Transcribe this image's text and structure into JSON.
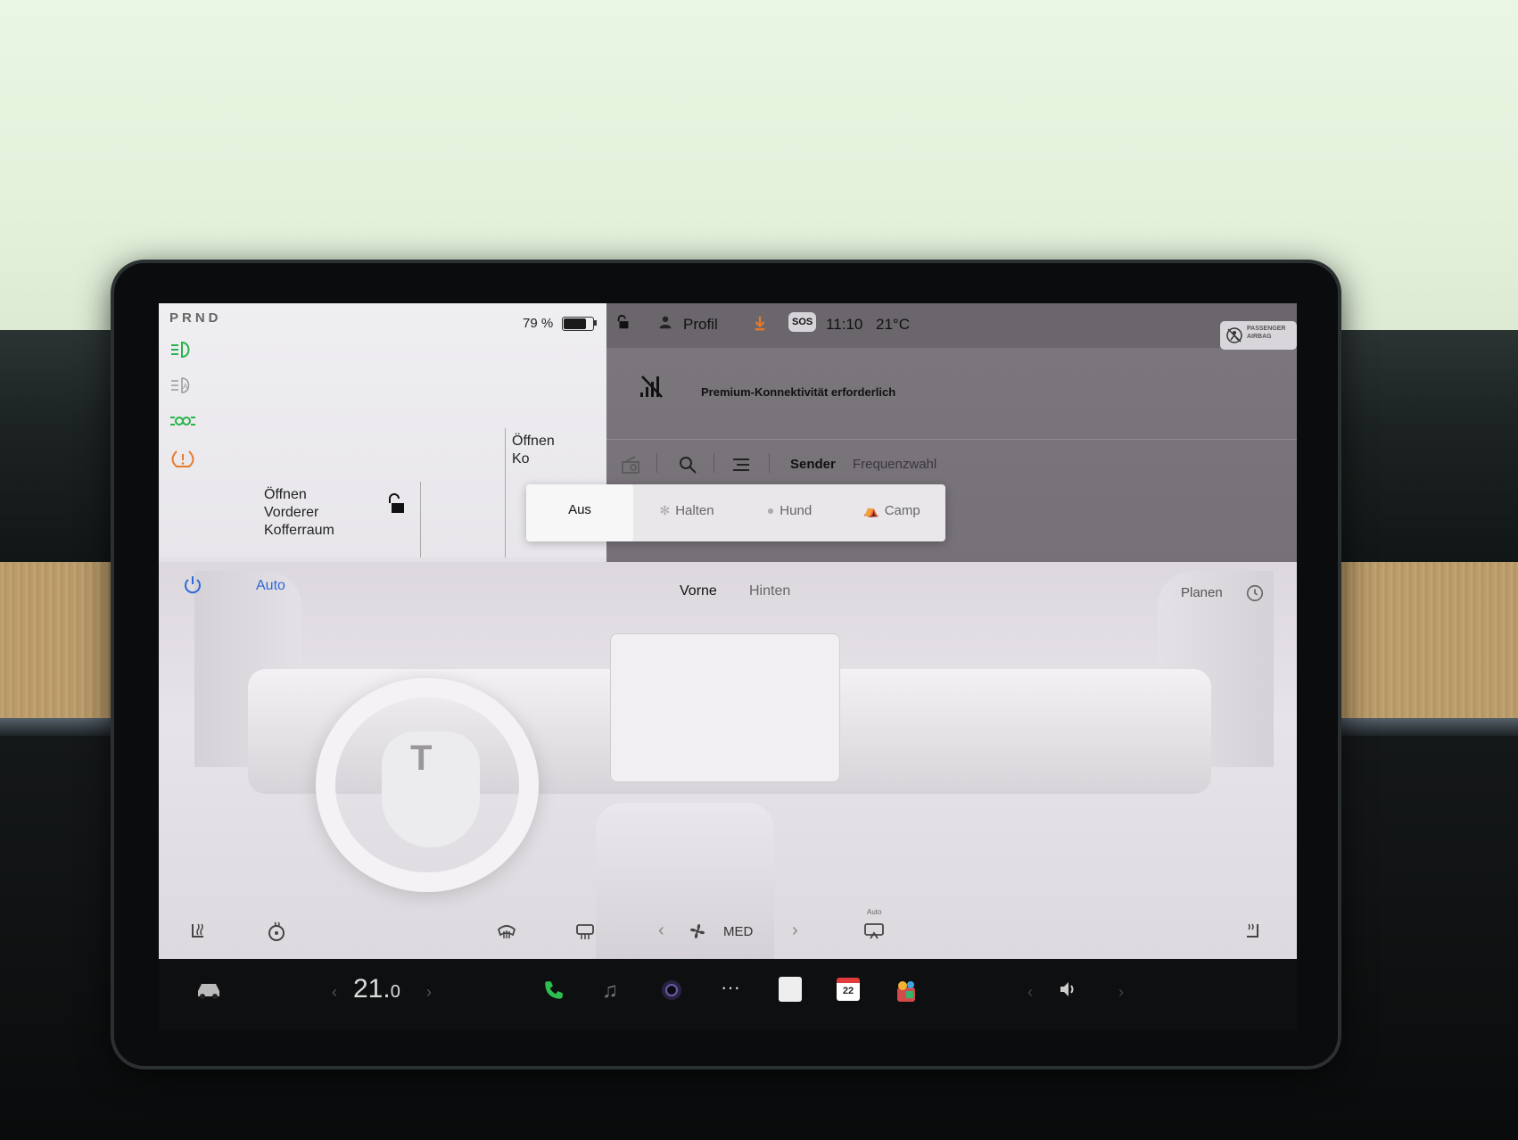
{
  "gear": "PRND",
  "battery": {
    "percent_label": "79 %",
    "level": 0.79
  },
  "car_panel": {
    "front_trunk": {
      "line1": "Öffnen",
      "line2": "Vorderer",
      "line3": "Kofferraum"
    },
    "rear_trunk": {
      "line1": "Öffnen",
      "line2": "Ko"
    }
  },
  "status_bar": {
    "profile_label": "Profil",
    "sos_label": "SOS",
    "time": "11:10",
    "outside_temp": "21°C",
    "airbag_label_1": "PASSENGER",
    "airbag_label_2": "AIRBAG"
  },
  "media": {
    "connectivity_message": "Premium-Konnektivität erforderlich",
    "tab_sender": "Sender",
    "tab_frequency": "Frequenzwahl"
  },
  "climate_mode_popup": {
    "options": [
      "Aus",
      "Halten",
      "Hund",
      "Camp"
    ],
    "selected": "Aus"
  },
  "climate": {
    "auto_label": "Auto",
    "tab_front": "Vorne",
    "tab_rear": "Hinten",
    "schedule_label": "Planen",
    "fan_label": "MED",
    "recirc_auto_label": "Auto"
  },
  "dock": {
    "temperature_main": "21.",
    "temperature_decimal": "0",
    "calendar_day": "22"
  },
  "colors": {
    "headlight_green": "#27b34a",
    "warning_orange": "#e8792a",
    "accent_blue": "#2e67d6",
    "phone_green": "#2fbf4f",
    "calendar_red": "#e23b3b"
  }
}
